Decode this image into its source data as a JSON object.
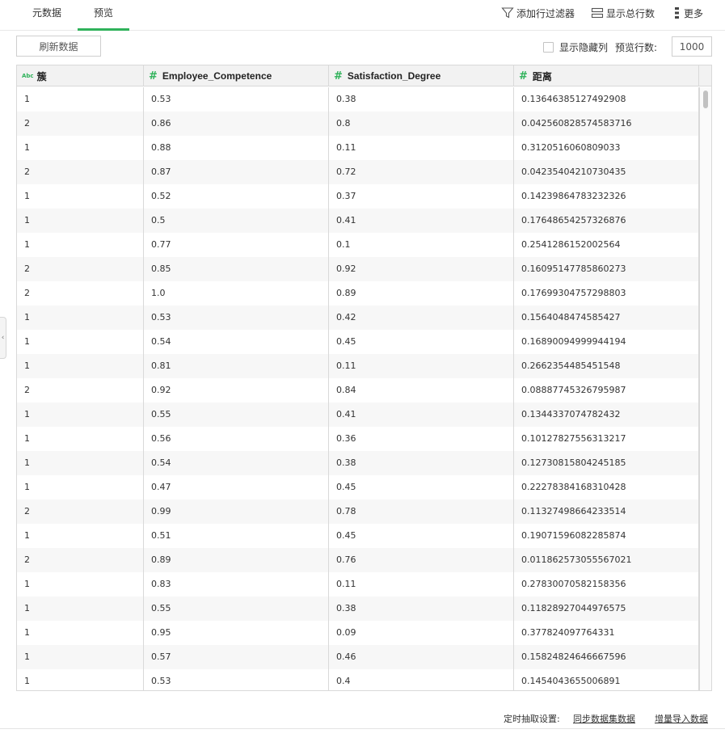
{
  "tabs": {
    "metadata": "元数据",
    "preview": "预览"
  },
  "toolbar": {
    "add_filter": "添加行过滤器",
    "show_total": "显示总行数",
    "more": "更多"
  },
  "controls": {
    "refresh": "刷新数据",
    "show_hidden_columns": "显示隐藏列",
    "preview_rows_label": "预览行数:",
    "preview_rows_value": "1000"
  },
  "table": {
    "columns": [
      {
        "name": "簇",
        "type": "Abc"
      },
      {
        "name": "Employee_Competence",
        "type": "#"
      },
      {
        "name": "Satisfaction_Degree",
        "type": "#"
      },
      {
        "name": "距离",
        "type": "#"
      }
    ],
    "rows": [
      [
        "1",
        "0.53",
        "0.38",
        "0.13646385127492908"
      ],
      [
        "2",
        "0.86",
        "0.8",
        "0.042560828574583716"
      ],
      [
        "1",
        "0.88",
        "0.11",
        "0.3120516060809033"
      ],
      [
        "2",
        "0.87",
        "0.72",
        "0.04235404210730435"
      ],
      [
        "1",
        "0.52",
        "0.37",
        "0.14239864783232326"
      ],
      [
        "1",
        "0.5",
        "0.41",
        "0.17648654257326876"
      ],
      [
        "1",
        "0.77",
        "0.1",
        "0.2541286152002564"
      ],
      [
        "2",
        "0.85",
        "0.92",
        "0.16095147785860273"
      ],
      [
        "2",
        "1.0",
        "0.89",
        "0.17699304757298803"
      ],
      [
        "1",
        "0.53",
        "0.42",
        "0.1564048474585427"
      ],
      [
        "1",
        "0.54",
        "0.45",
        "0.16890094999944194"
      ],
      [
        "1",
        "0.81",
        "0.11",
        "0.2662354485451548"
      ],
      [
        "2",
        "0.92",
        "0.84",
        "0.08887745326795987"
      ],
      [
        "1",
        "0.55",
        "0.41",
        "0.1344337074782432"
      ],
      [
        "1",
        "0.56",
        "0.36",
        "0.10127827556313217"
      ],
      [
        "1",
        "0.54",
        "0.38",
        "0.12730815804245185"
      ],
      [
        "1",
        "0.47",
        "0.45",
        "0.22278384168310428"
      ],
      [
        "2",
        "0.99",
        "0.78",
        "0.11327498664233514"
      ],
      [
        "1",
        "0.51",
        "0.45",
        "0.19071596082285874"
      ],
      [
        "2",
        "0.89",
        "0.76",
        "0.011862573055567021"
      ],
      [
        "1",
        "0.83",
        "0.11",
        "0.27830070582158356"
      ],
      [
        "1",
        "0.55",
        "0.38",
        "0.11828927044976575"
      ],
      [
        "1",
        "0.95",
        "0.09",
        "0.377824097764331"
      ],
      [
        "1",
        "0.57",
        "0.46",
        "0.15824824646667596"
      ],
      [
        "1",
        "0.53",
        "0.4",
        "0.1454043655006891"
      ]
    ]
  },
  "footer": {
    "schedule_label": "定时抽取设置:",
    "sync_link": "同步数据集数据",
    "import_link": "增量导入数据"
  },
  "colors": {
    "accent": "#2fb25a"
  }
}
